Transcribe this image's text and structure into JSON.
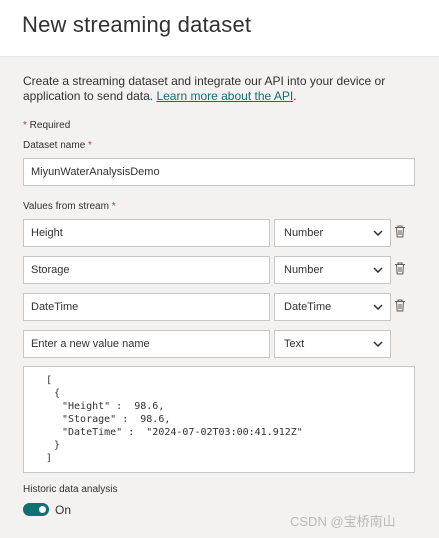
{
  "dialog": {
    "title": "New streaming dataset",
    "description_text": "Create a streaming dataset and integrate our API into your device or application to send data. ",
    "learn_more_link": "Learn more about the API",
    "description_end": "."
  },
  "form": {
    "required_note": "Required",
    "dataset_name_label": "Dataset name",
    "dataset_name_value": "MiyunWaterAnalysisDemo",
    "values_label": "Values from stream",
    "values": [
      {
        "name": "Height",
        "type": "Number",
        "deletable": true
      },
      {
        "name": "Storage",
        "type": "Number",
        "deletable": true
      },
      {
        "name": "DateTime",
        "type": "DateTime",
        "deletable": true
      }
    ],
    "new_value_placeholder": "Enter a new value name",
    "new_value_type": "Text",
    "json_preview": {
      "open_bracket": "[",
      "open_brace": "{",
      "line_height": "\"Height\" :  98.6,",
      "line_storage": "\"Storage\" :  98.6,",
      "line_datetime": "\"DateTime\" :  \"2024-07-02T03:00:41.912Z\"",
      "close_brace": "}",
      "close_bracket": "]"
    },
    "historic_label": "Historic data analysis",
    "historic_state": "On"
  },
  "watermark": "CSDN @宝桥南山",
  "colors": {
    "accent": "#0f6f71",
    "required": "#c4314b"
  },
  "icons": {
    "delete": "trash-icon",
    "dropdown": "chevron-down-icon"
  }
}
